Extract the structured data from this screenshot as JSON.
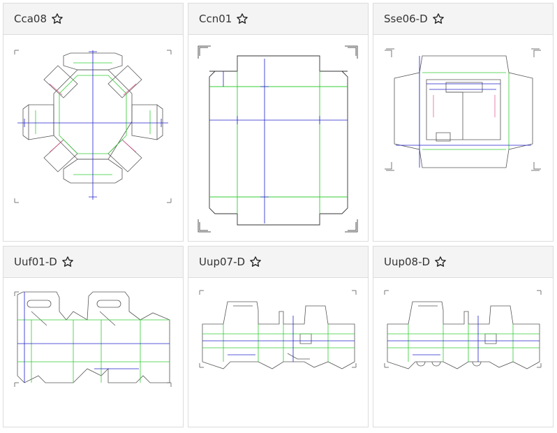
{
  "cards": [
    {
      "title": "Cca08",
      "favorite_icon": "star-outline-icon"
    },
    {
      "title": "Ccn01",
      "favorite_icon": "star-outline-icon"
    },
    {
      "title": "Sse06-D",
      "favorite_icon": "star-outline-icon"
    },
    {
      "title": "Uuf01-D",
      "favorite_icon": "star-outline-icon"
    },
    {
      "title": "Uup07-D",
      "favorite_icon": "star-outline-icon"
    },
    {
      "title": "Uup08-D",
      "favorite_icon": "star-outline-icon"
    }
  ],
  "colors": {
    "cut_line": "#555555",
    "fold_line": "#33cc33",
    "dimension_line": "#2222cc",
    "perforation_line": "#dd3377"
  }
}
